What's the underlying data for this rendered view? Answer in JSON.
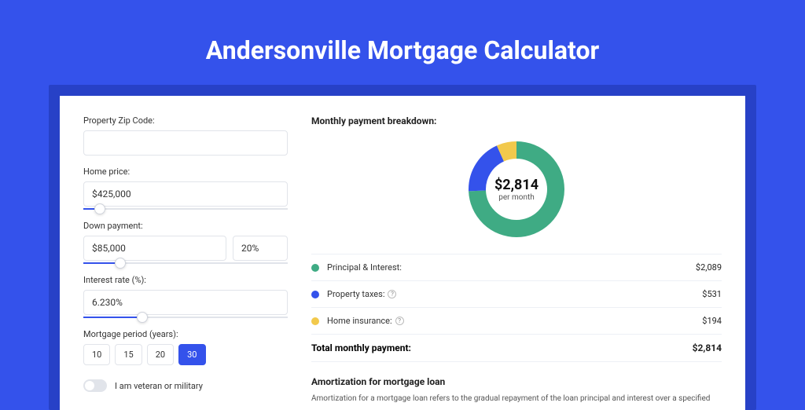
{
  "header": {
    "title": "Andersonville Mortgage Calculator"
  },
  "form": {
    "zip": {
      "label": "Property Zip Code:",
      "value": ""
    },
    "home_price": {
      "label": "Home price:",
      "value": "$425,000",
      "slider_pct": 8
    },
    "down_payment": {
      "label": "Down payment:",
      "amount": "$85,000",
      "pct": "20%",
      "slider_pct": 18
    },
    "interest": {
      "label": "Interest rate (%):",
      "value": "6.230%",
      "slider_pct": 29
    },
    "period": {
      "label": "Mortgage period (years):",
      "options": [
        "10",
        "15",
        "20",
        "30"
      ],
      "active": "30"
    },
    "veteran": {
      "label": "I am veteran or military",
      "on": false
    }
  },
  "breakdown": {
    "title": "Monthly payment breakdown:",
    "center_value": "$2,814",
    "center_sub": "per month",
    "items": [
      {
        "label": "Principal & Interest:",
        "value": "$2,089",
        "color": "#3fab84",
        "info": false
      },
      {
        "label": "Property taxes:",
        "value": "$531",
        "color": "#3452eb",
        "info": true
      },
      {
        "label": "Home insurance:",
        "value": "$194",
        "color": "#f2c94c",
        "info": true
      }
    ],
    "total_label": "Total monthly payment:",
    "total_value": "$2,814"
  },
  "chart_data": {
    "type": "pie",
    "title": "Monthly payment breakdown",
    "categories": [
      "Principal & Interest",
      "Property taxes",
      "Home insurance"
    ],
    "values": [
      2089,
      531,
      194
    ],
    "colors": [
      "#3fab84",
      "#3452eb",
      "#f2c94c"
    ],
    "total": 2814
  },
  "amort": {
    "title": "Amortization for mortgage loan",
    "text": "Amortization for a mortgage loan refers to the gradual repayment of the loan principal and interest over a specified"
  }
}
